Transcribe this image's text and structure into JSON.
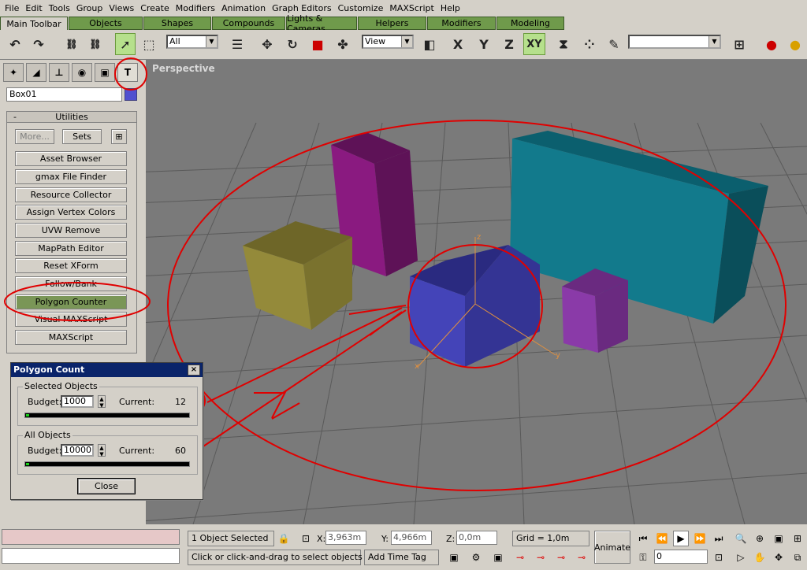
{
  "menu": [
    "File",
    "Edit",
    "Tools",
    "Group",
    "Views",
    "Create",
    "Modifiers",
    "Animation",
    "Graph Editors",
    "Customize",
    "MAXScript",
    "Help"
  ],
  "tabs": [
    "Main Toolbar",
    "Objects",
    "Shapes",
    "Compounds",
    "Lights & Cameras",
    "Helpers",
    "Modifiers",
    "Modeling"
  ],
  "toolbar": {
    "selection_filter": "All",
    "ref_coord": "View",
    "axis_x": "X",
    "axis_y": "Y",
    "axis_z": "Z",
    "axis_xy": "XY",
    "named_sel": ""
  },
  "object_name": "Box01",
  "utilities": {
    "title": "Utilities",
    "collapse": "-",
    "more_label": "More...",
    "sets_label": "Sets",
    "buttons": [
      "Asset Browser",
      "gmax File Finder",
      "Resource Collector",
      "Assign Vertex Colors",
      "UVW Remove",
      "MapPath Editor",
      "Reset XForm",
      "Follow/Bank",
      "Polygon Counter",
      "Visual MAXScript",
      "MAXScript"
    ]
  },
  "polygon_dialog": {
    "title": "Polygon Count",
    "close_x": "×",
    "selected": {
      "label": "Selected Objects",
      "budget_label": "Budget:",
      "budget": "1000",
      "current_label": "Current:",
      "current": "12",
      "fill": 0.012
    },
    "all": {
      "label": "All Objects",
      "budget_label": "Budget:",
      "budget": "10000",
      "current_label": "Current:",
      "current": "60",
      "fill": 0.006
    },
    "close_label": "Close"
  },
  "viewport": {
    "label": "Perspective",
    "axis_labels": {
      "x": "x",
      "y": "y",
      "z": "z"
    }
  },
  "colors": {
    "yellow_box": "#8a7f33",
    "magenta_box": "#7a1570",
    "teal_box": "#0e6e80",
    "blue_box": "#3a3aa0",
    "purple_box": "#8a3aa0",
    "annotation": "#e00000"
  },
  "status": {
    "selected": "1 Object Selected",
    "prompt": "Click or click-and-drag to select objects",
    "x_label": "X:",
    "x": "3,963m",
    "y_label": "Y:",
    "y": "4,966m",
    "z_label": "Z:",
    "z": "0,0m",
    "grid": "Grid = 1,0m",
    "add_time_tag": "Add Time Tag",
    "animate": "Animate",
    "frame": "0"
  }
}
